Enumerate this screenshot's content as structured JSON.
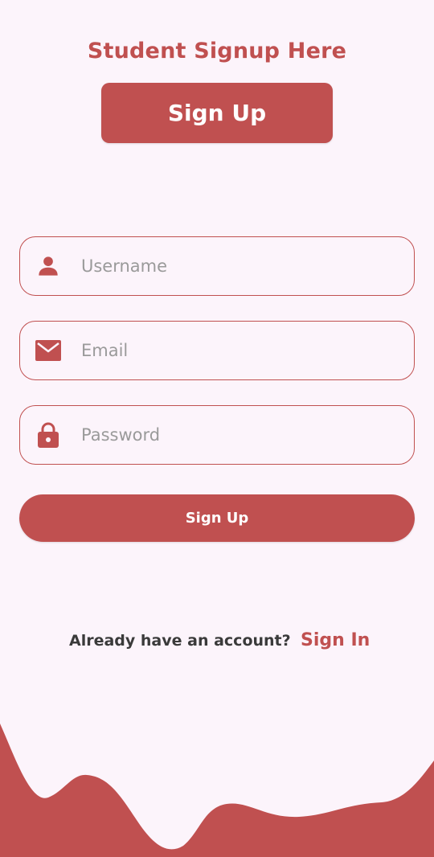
{
  "header": {
    "title": "Student Signup Here",
    "button_label": "Sign Up"
  },
  "form": {
    "username": {
      "placeholder": "Username",
      "value": "",
      "icon": "person-icon"
    },
    "email": {
      "placeholder": "Email",
      "value": "",
      "icon": "mail-icon"
    },
    "password": {
      "placeholder": "Password",
      "value": "",
      "icon": "lock-icon"
    },
    "submit_label": "Sign Up"
  },
  "footer": {
    "prompt": "Already have an account?",
    "link_label": "Sign In"
  },
  "colors": {
    "accent": "#c05050",
    "background": "#fcf4fb",
    "placeholder": "#9a9a9a",
    "text": "#3a3a3a"
  }
}
